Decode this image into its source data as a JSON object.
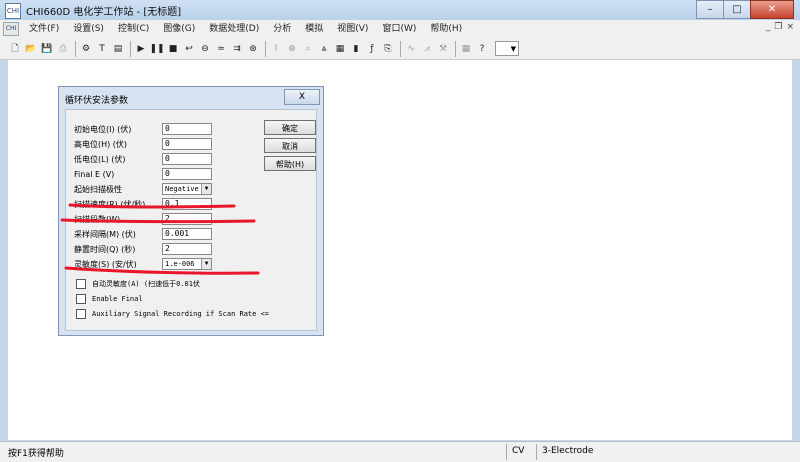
{
  "window": {
    "title": "CHI660D 电化学工作站 - [无标题]",
    "app_icon": "CHI"
  },
  "menu": [
    "文件(F)",
    "设置(S)",
    "控制(C)",
    "图像(G)",
    "数据处理(D)",
    "分析",
    "模拟",
    "视图(V)",
    "窗口(W)",
    "帮助(H)"
  ],
  "toolbar": {
    "combo_arrow": "▼"
  },
  "dialog": {
    "title": "循环伏安法参数",
    "close": "X",
    "fields": [
      {
        "label": "初始电位(I) (伏)",
        "value": "0"
      },
      {
        "label": "高电位(H) (伏)",
        "value": "0"
      },
      {
        "label": "低电位(L) (伏)",
        "value": "0"
      },
      {
        "label": "Final E (V)",
        "value": "0"
      },
      {
        "label": "起始扫描极性",
        "value": "Negative"
      },
      {
        "label": "扫描速度(R) (伏/秒)",
        "value": "0.1"
      },
      {
        "label": "扫描段数(W)",
        "value": "2"
      },
      {
        "label": "采样间隔(M) (伏)",
        "value": "0.001"
      },
      {
        "label": "静置时间(Q) (秒)",
        "value": "2"
      },
      {
        "label": "灵敏度(S) (安/伏)",
        "value": "1.e-006"
      }
    ],
    "buttons": {
      "ok": "确定",
      "cancel": "取消",
      "help": "帮助(H)"
    },
    "checkboxes": {
      "auto_sens": "自动灵敏度(A) (扫速低于0.01伏",
      "enable_final": "Enable Final",
      "aux": "Auxiliary Signal Recording if Scan Rate <="
    }
  },
  "status": {
    "help": "按F1获得帮助",
    "technique": "CV",
    "electrode": "3-Electrode"
  },
  "colors": {
    "annotation": "#e8172c"
  }
}
